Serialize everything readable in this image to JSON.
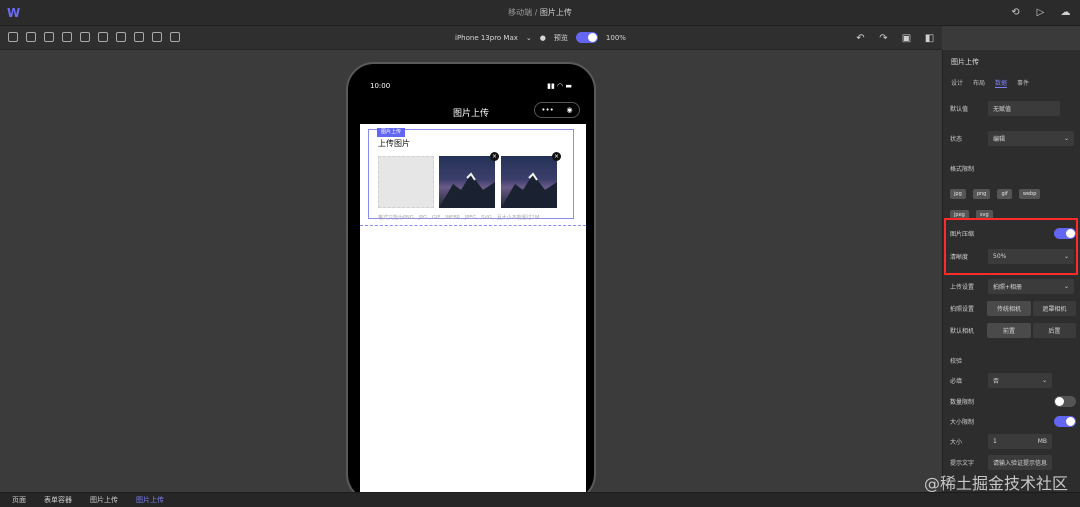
{
  "header": {
    "crumb_parent": "移动端",
    "crumb_sep": "/",
    "crumb_current": "图片上传",
    "icons": [
      "history-icon",
      "play-icon",
      "cloud-icon"
    ]
  },
  "toolbar": {
    "device": "iPhone 13pro Max",
    "preview_label": "预览",
    "zoom": "100%"
  },
  "phone": {
    "time": "10:00",
    "page_title": "图片上传",
    "component_tag": "图片上传",
    "upload_label": "上传图片",
    "hint": "格式只能为PNG、JPG、GIF、WEBP、JPEG、SVG，且大小不能超过1M"
  },
  "panel": {
    "title": "图片上传",
    "tabs": [
      "设计",
      "布局",
      "数据",
      "事件"
    ],
    "active_tab": "数据",
    "default_label": "默认值",
    "default_value": "无赋值",
    "status_label": "状态",
    "status_value": "编辑",
    "format_label": "格式限制",
    "formats": [
      "jpg",
      "png",
      "gif",
      "webp",
      "jpeg",
      "svg"
    ],
    "compress_label": "图片压缩",
    "clarity_label": "清晰度",
    "clarity_value": "50%",
    "upload_setting_label": "上传设置",
    "upload_setting_value": "拍照+相册",
    "shoot_setting_label": "拍照设置",
    "shoot_opt1": "传统相机",
    "shoot_opt2": "遮罩相机",
    "camera_label": "默认相机",
    "camera_opt1": "前置",
    "camera_opt2": "后置",
    "section_validate": "校验",
    "required_label": "必填",
    "required_value": "否",
    "count_limit_label": "数量限制",
    "size_limit_label": "大小限制",
    "size_label": "大小",
    "size_value": "1",
    "size_unit": "MB",
    "tip_label": "提示文字",
    "tip_placeholder": "请输入验证提示信息"
  },
  "bottom": {
    "items": [
      "页面",
      "表单容器",
      "图片上传",
      "图片上传"
    ],
    "active": "图片上传"
  },
  "watermark": "@稀土掘金技术社区"
}
